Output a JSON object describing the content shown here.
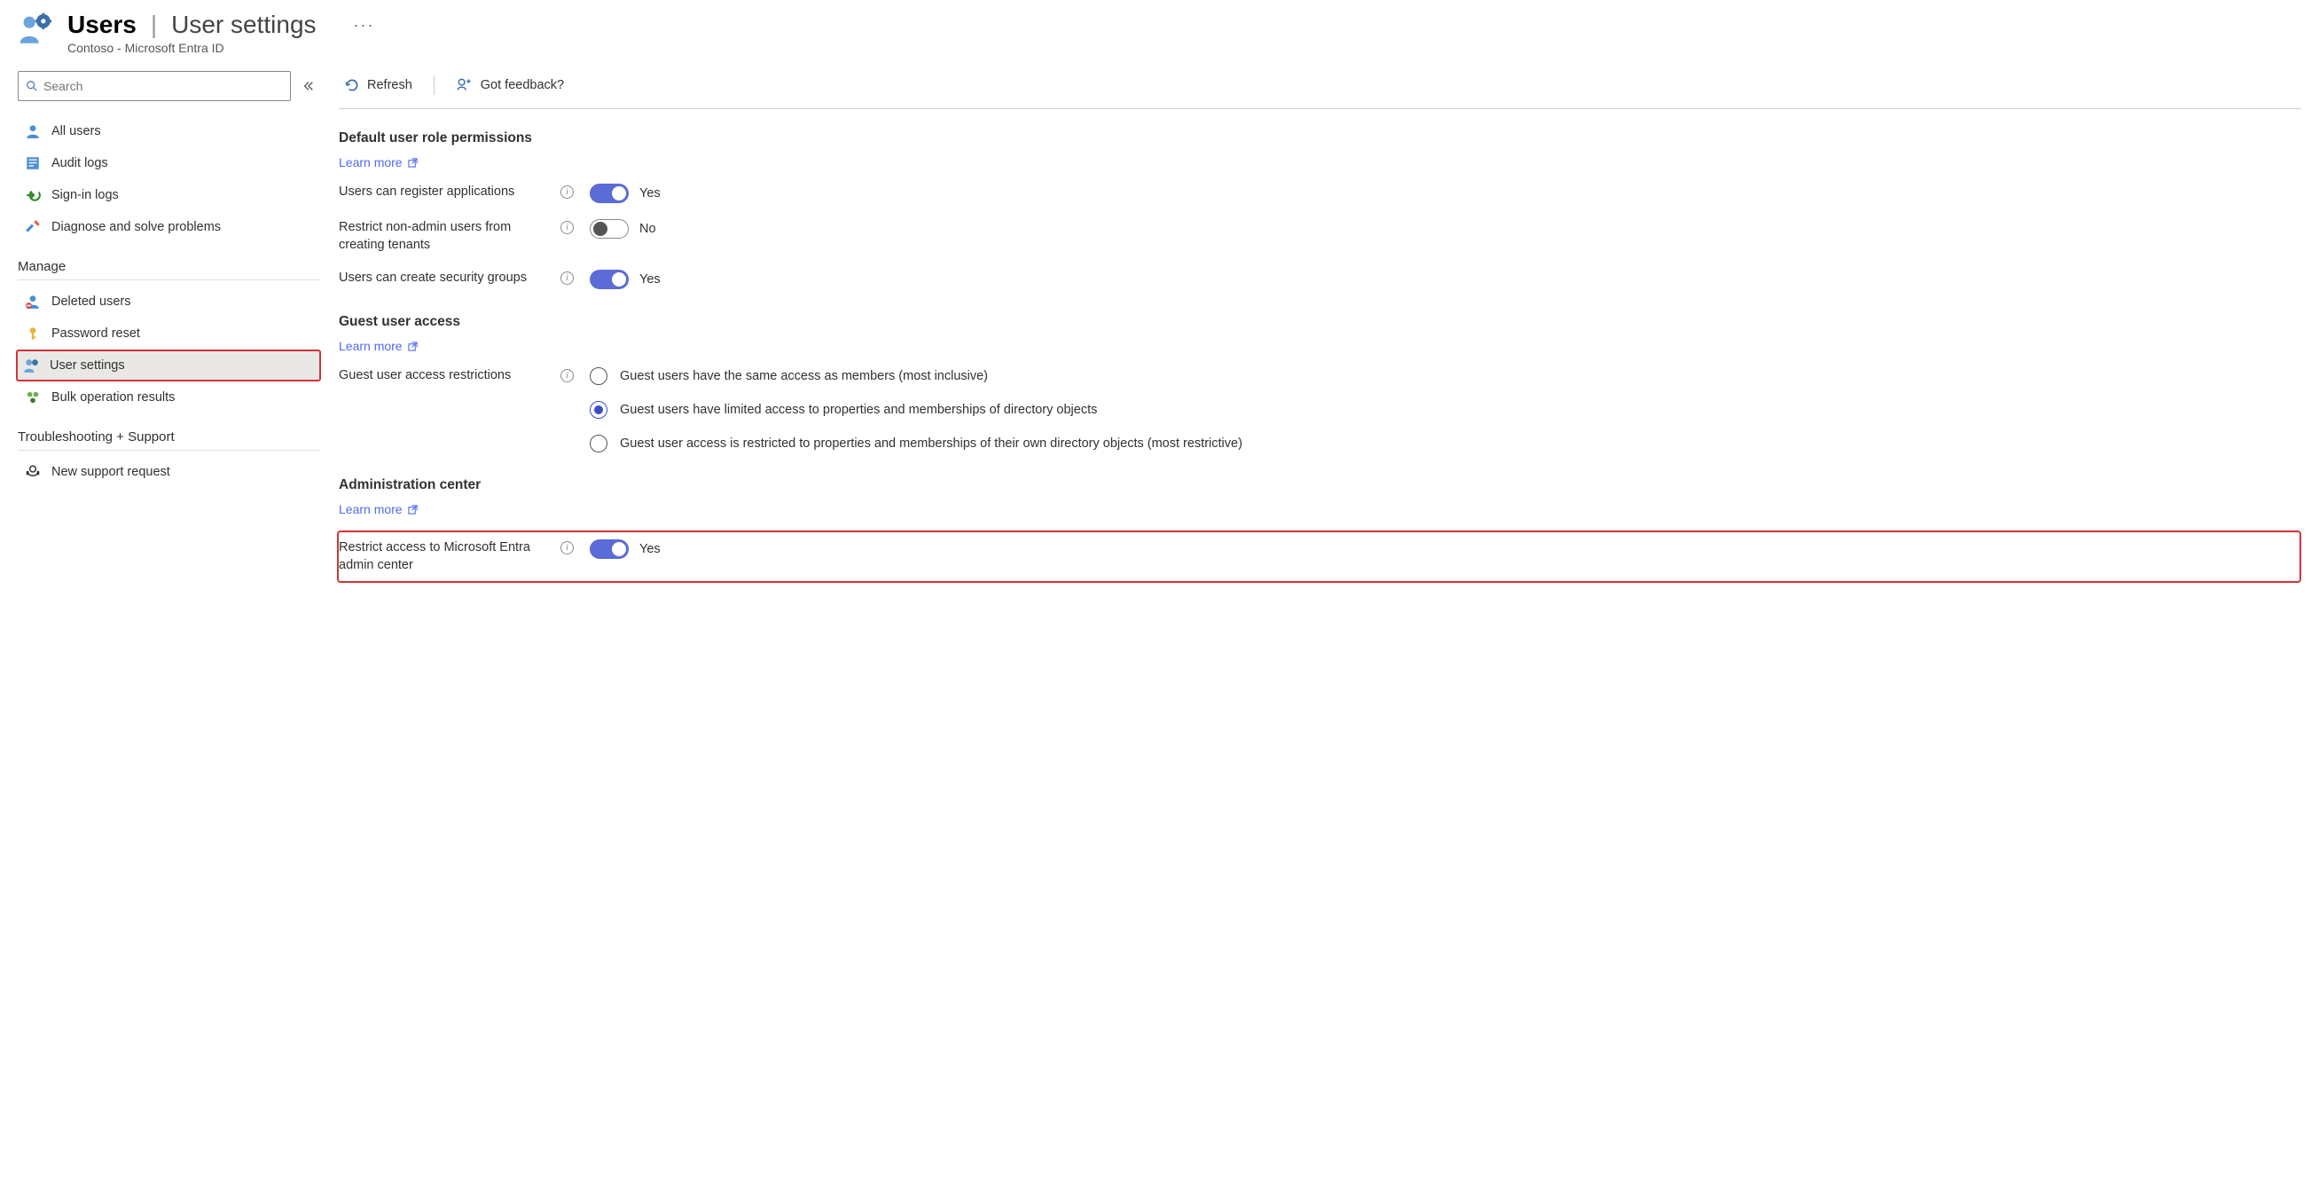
{
  "header": {
    "title_main": "Users",
    "title_sub": "User settings",
    "subtitle": "Contoso - Microsoft Entra ID",
    "more": "···"
  },
  "search": {
    "placeholder": "Search"
  },
  "sidebar": {
    "top": [
      {
        "label": "All users"
      },
      {
        "label": "Audit logs"
      },
      {
        "label": "Sign-in logs"
      },
      {
        "label": "Diagnose and solve problems"
      }
    ],
    "manage_label": "Manage",
    "manage": [
      {
        "label": "Deleted users"
      },
      {
        "label": "Password reset"
      },
      {
        "label": "User settings"
      },
      {
        "label": "Bulk operation results"
      }
    ],
    "support_label": "Troubleshooting + Support",
    "support": [
      {
        "label": "New support request"
      }
    ]
  },
  "commands": {
    "refresh": "Refresh",
    "feedback": "Got feedback?"
  },
  "sections": {
    "default_perms": {
      "title": "Default user role permissions",
      "learn_more": "Learn more",
      "rows": [
        {
          "label": "Users can register applications",
          "value": "Yes",
          "on": true
        },
        {
          "label": "Restrict non-admin users from creating tenants",
          "value": "No",
          "on": false
        },
        {
          "label": "Users can create security groups",
          "value": "Yes",
          "on": true
        }
      ]
    },
    "guest": {
      "title": "Guest user access",
      "learn_more": "Learn more",
      "label": "Guest user access restrictions",
      "options": [
        "Guest users have the same access as members (most inclusive)",
        "Guest users have limited access to properties and memberships of directory objects",
        "Guest user access is restricted to properties and memberships of their own directory objects (most restrictive)"
      ],
      "selected": 1
    },
    "admin_center": {
      "title": "Administration center",
      "learn_more": "Learn more",
      "row": {
        "label": "Restrict access to Microsoft Entra admin center",
        "value": "Yes",
        "on": true
      }
    }
  }
}
